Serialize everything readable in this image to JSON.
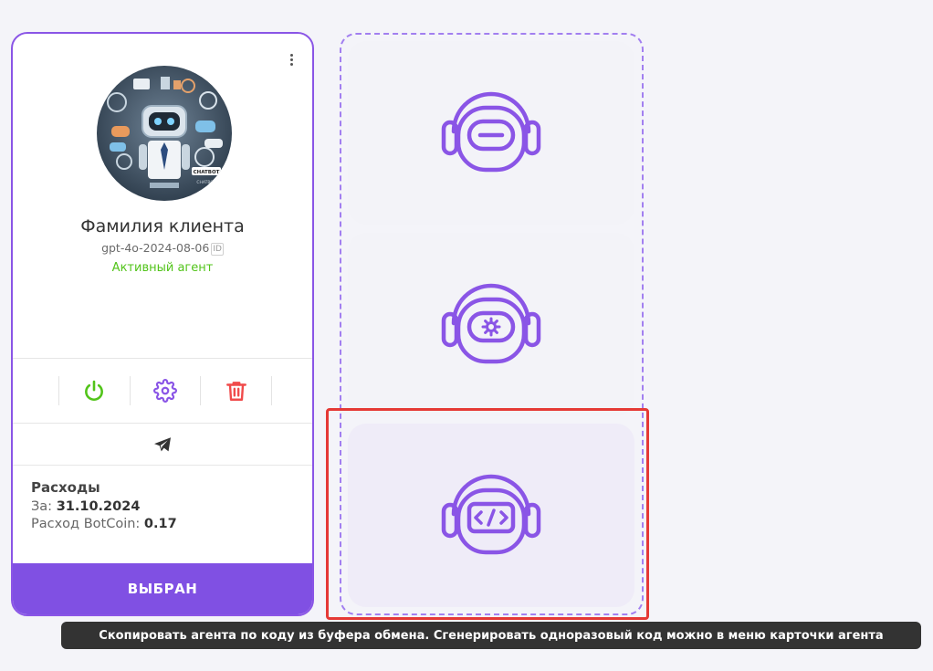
{
  "agent_card": {
    "name": "Фамилия клиента",
    "model": "gpt-4o-2024-08-06",
    "id_badge": "ID",
    "status": "Активный агент",
    "avatar": {
      "badge_text": "CHATBOT",
      "caption": "CHATBOT"
    },
    "expenses": {
      "title": "Расходы",
      "date_label": "За:",
      "date_value": "31.10.2024",
      "cost_label": "Расход BotCoin:",
      "cost_value": "0.17"
    },
    "select_label": "ВЫБРАН",
    "icons": {
      "menu": "more-vertical-icon",
      "power": "power-icon",
      "settings": "gear-icon",
      "delete": "trash-icon",
      "telegram": "telegram-icon"
    }
  },
  "add_options": [
    {
      "icon": "robot-headset-blank-icon"
    },
    {
      "icon": "robot-headset-gear-icon"
    },
    {
      "icon": "robot-headset-code-icon"
    }
  ],
  "tooltip": "Скопировать агента по коду из буфера обмена. Сгенерировать одноразовый код можно в меню карточки агента",
  "colors": {
    "accent": "#8050e3",
    "status_active": "#52c41a",
    "power": "#52c41a",
    "delete": "#f04b4b",
    "highlight": "#e53935"
  }
}
